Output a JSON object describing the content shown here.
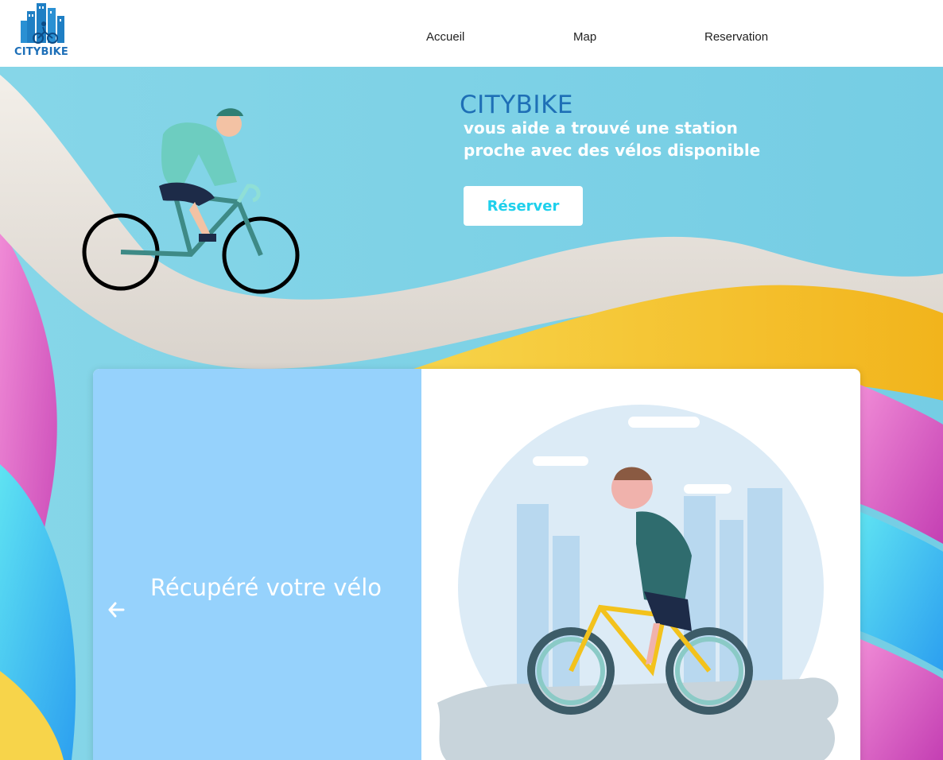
{
  "header": {
    "logo_text": "CITYBIKE",
    "nav": [
      {
        "label": "Accueil"
      },
      {
        "label": "Map"
      },
      {
        "label": "Reservation"
      }
    ]
  },
  "hero": {
    "title": "CITYBIKE",
    "subtitle": "vous aide a trouvé une station proche avec des vélos disponible",
    "cta_label": "Réserver"
  },
  "card": {
    "caption": "Récupéré votre vélo",
    "prev_icon": "arrow-left-icon"
  },
  "colors": {
    "brand_blue": "#1e6fb6",
    "cta_text": "#1ed0ec",
    "card_left_bg": "#96d2fc",
    "hero_bg": "#7fd2e6"
  }
}
